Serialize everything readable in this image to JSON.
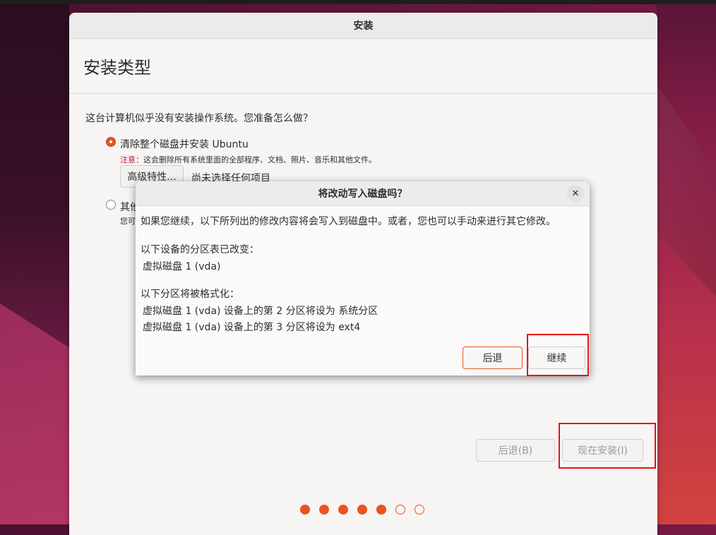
{
  "window": {
    "title": "安装",
    "page_title": "安装类型",
    "question": "这台计算机似乎没有安装操作系统。您准备怎么做？",
    "option1": {
      "label": "清除整个磁盘并安装 Ubuntu",
      "selected": true,
      "warning_key": "注意：",
      "warning_text": "这会删除所有系统里面的全部程序、文档、照片、音乐和其他文件。",
      "advanced_button": "高级特性...",
      "advanced_status": "尚未选择任何项目"
    },
    "option2": {
      "label_visible": "其他",
      "note_visible": "您可",
      "selected": false
    },
    "back_button": "后退(B)",
    "install_button": "现在安装(I)",
    "progress": {
      "total_steps": 7,
      "completed_steps": 5
    }
  },
  "dialog": {
    "title": "将改动写入磁盘吗？",
    "intro": "如果您继续，以下所列出的修改内容将会写入到磁盘中。或者，您也可以手动来进行其它修改。",
    "partition_tables_heading": "以下设备的分区表已改变：",
    "partition_tables_items": [
      "虚拟磁盘 1 (vda)"
    ],
    "format_heading": "以下分区将被格式化：",
    "format_items": [
      "虚拟磁盘 1 (vda) 设备上的第 2 分区将设为 系统分区",
      "虚拟磁盘 1 (vda) 设备上的第 3 分区将设为 ext4"
    ],
    "back_button": "后退",
    "continue_button": "继续",
    "close_glyph": "✕"
  },
  "colors": {
    "accent": "#e95420",
    "highlight": "#e0141a",
    "warning": "#c7162b"
  }
}
